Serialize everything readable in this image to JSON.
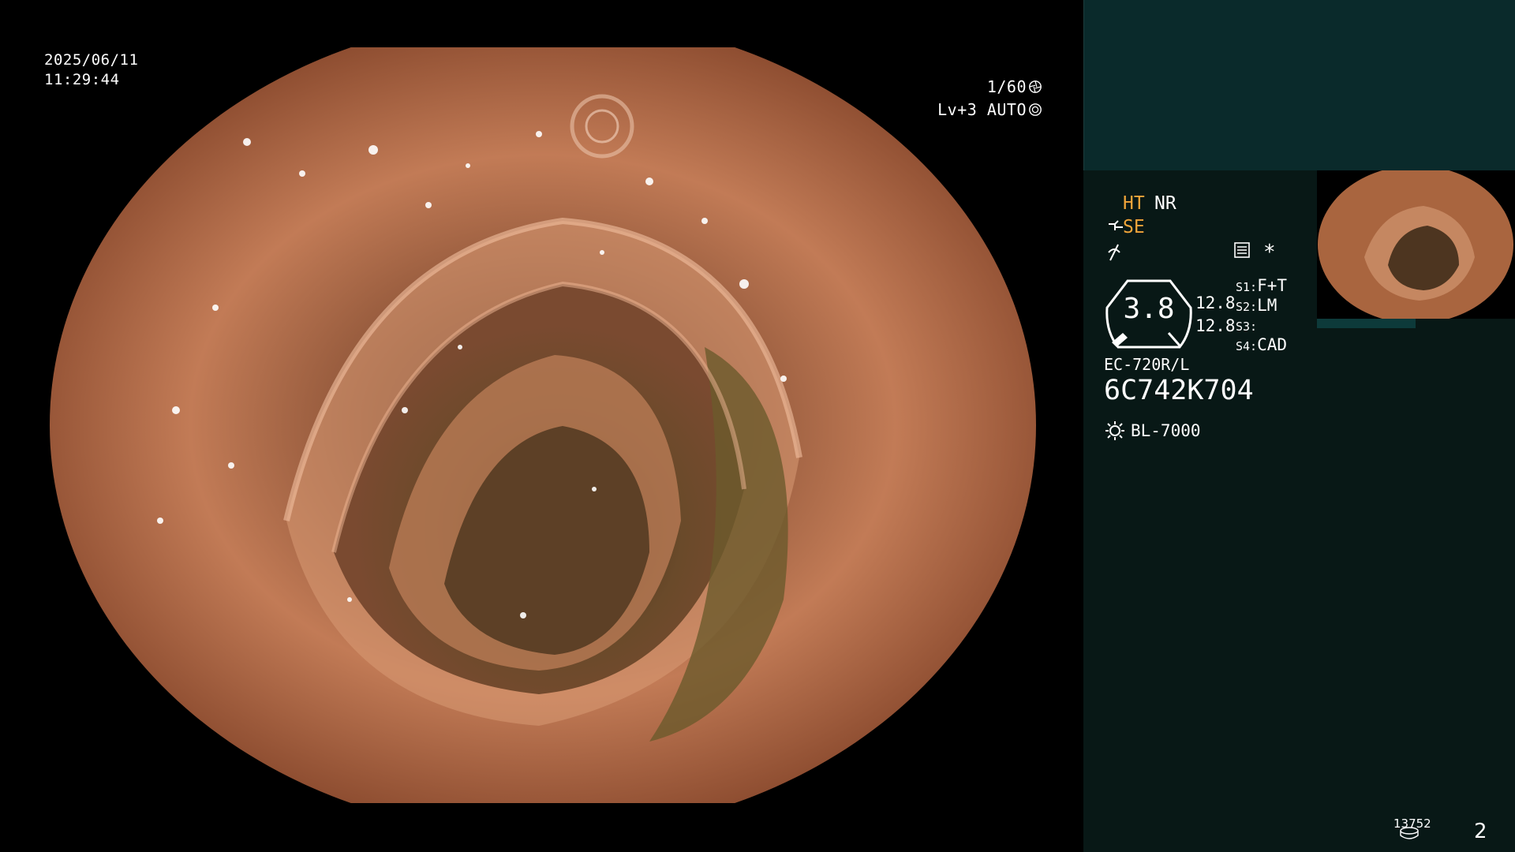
{
  "osd": {
    "date": "2025/06/11",
    "time": "11:29:44",
    "shutter": "1/60",
    "level": "Lv+3 AUTO"
  },
  "panel": {
    "ht": "HT",
    "nr": "NR",
    "se": "SE",
    "asterisk": "*",
    "gauge_value": "3.8",
    "gauge_upper": "12.8",
    "gauge_lower": "12.8",
    "s1_label": "S1:",
    "s1_value": "F+T",
    "s2_label": "S2:",
    "s2_value": "LM",
    "s3_label": "S3:",
    "s3_value": "",
    "s4_label": "S4:",
    "s4_value": "CAD",
    "scope_model": "EC-720R/L",
    "scope_serial": "6C742K704",
    "light_source": "BL-7000"
  },
  "footer": {
    "image_count": "13752",
    "page_number": "2"
  },
  "colors": {
    "accent_orange": "#f2a53a",
    "panel_dark": "#081816",
    "panel_top": "#0a2a2b"
  },
  "icons": [
    "shutter-icon",
    "auto-iris-icon",
    "se-scope-icon",
    "noise-reduction-icon",
    "menu-list-icon",
    "light-source-icon",
    "storage-icon"
  ]
}
